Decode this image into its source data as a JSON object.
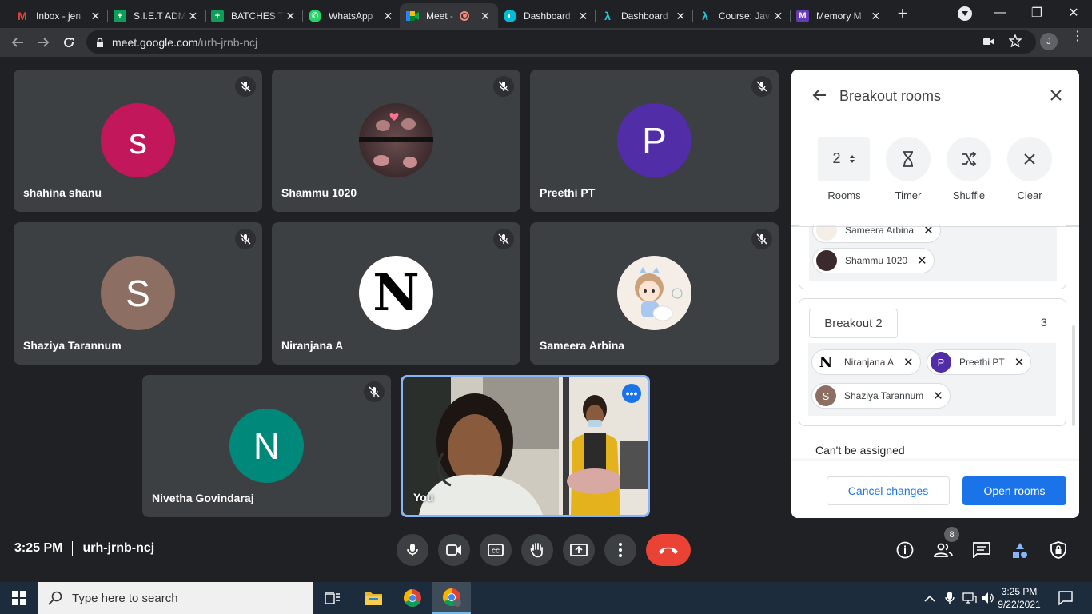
{
  "browser": {
    "tabs": [
      {
        "title": "Inbox - jen",
        "icon": "gmail-icon",
        "color": "#ea4335",
        "glyph": "M"
      },
      {
        "title": "S.I.E.T ADM",
        "icon": "sheets-icon",
        "color": "#0f9d58",
        "glyph": "+"
      },
      {
        "title": "BATCHES T",
        "icon": "sheets-icon",
        "color": "#0f9d58",
        "glyph": "+"
      },
      {
        "title": "WhatsApp",
        "icon": "whatsapp-icon",
        "color": "#25d366",
        "glyph": "✆"
      },
      {
        "title": "Meet -",
        "icon": "meet-icon",
        "color": "#00897b",
        "glyph": "▶"
      },
      {
        "title": "Dashboard",
        "icon": "dashboard-icon",
        "color": "#00bcd4",
        "glyph": "◐"
      },
      {
        "title": "Dashboard",
        "icon": "course-icon",
        "color": "#26c6da",
        "glyph": "λ"
      },
      {
        "title": "Course: Jav",
        "icon": "course-icon",
        "color": "#26c6da",
        "glyph": "λ"
      },
      {
        "title": "Memory M",
        "icon": "memory-icon",
        "color": "#673ab7",
        "glyph": "M"
      }
    ],
    "url_host": "meet.google.com",
    "url_path": "/urh-jrnb-ncj",
    "profile_initial": "J"
  },
  "participants": [
    {
      "name": "shahina shanu",
      "initial": "s",
      "color": "#c2185b"
    },
    {
      "name": "Shammu 1020",
      "initial": "",
      "color": "#3a2a2c"
    },
    {
      "name": "Preethi PT",
      "initial": "P",
      "color": "#512da8"
    },
    {
      "name": "Shaziya Tarannum",
      "initial": "S",
      "color": "#8d6e63"
    },
    {
      "name": "Niranjana A",
      "initial": "N",
      "color": "#ffffff"
    },
    {
      "name": "Sameera Arbina",
      "initial": "",
      "color": "#f5eee7"
    },
    {
      "name": "Nivetha Govindaraj",
      "initial": "N",
      "color": "#00897b"
    }
  ],
  "self": {
    "name": "You"
  },
  "panel": {
    "title": "Breakout rooms",
    "rooms_count": "2",
    "controls": {
      "rooms": "Rooms",
      "timer": "Timer",
      "shuffle": "Shuffle",
      "clear": "Clear"
    },
    "breakout1_members": [
      {
        "name": "Sameera Arbina",
        "initial": "",
        "color": "#f5eee7"
      },
      {
        "name": "Shammu 1020",
        "initial": "",
        "color": "#3a2a2c"
      }
    ],
    "breakout2": {
      "name": "Breakout 2",
      "count": "3",
      "members": [
        {
          "name": "Niranjana A",
          "initial": "N",
          "color": "#ffffff"
        },
        {
          "name": "Preethi PT",
          "initial": "P",
          "color": "#512da8"
        },
        {
          "name": "Shaziya Tarannum",
          "initial": "S",
          "color": "#8d6e63"
        }
      ]
    },
    "unassigned_label": "Can't be assigned",
    "cancel_label": "Cancel changes",
    "open_label": "Open rooms"
  },
  "meeting": {
    "time": "3:25 PM",
    "code": "urh-jrnb-ncj",
    "people_count": "8"
  },
  "taskbar": {
    "search_placeholder": "Type here to search",
    "time": "3:25 PM",
    "date": "9/22/2021"
  }
}
